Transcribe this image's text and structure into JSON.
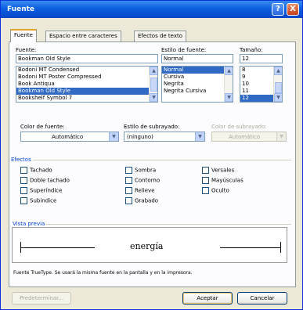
{
  "window": {
    "title": "Fuente",
    "help_glyph": "?",
    "close_glyph": "X"
  },
  "tabs": [
    "Fuente",
    "Espacio entre caracteres",
    "Efectos de texto"
  ],
  "font": {
    "label": "Fuente:",
    "value": "Bookman Old Style",
    "items": [
      "Bodoni MT Condensed",
      "Bodoni MT Poster Compressed",
      "Book Antiqua",
      "Bookman Old Style",
      "Bookshelf Symbol 7"
    ],
    "selected_index": 3
  },
  "style": {
    "label": "Estilo de fuente:",
    "value": "Normal",
    "items": [
      "Normal",
      "Cursiva",
      "Negrita",
      "Negrita Cursiva"
    ],
    "selected_index": 0
  },
  "size": {
    "label": "Tamaño:",
    "value": "12",
    "items": [
      "8",
      "9",
      "10",
      "11",
      "12"
    ],
    "selected_index": 4
  },
  "color": {
    "label": "Color de fuente:",
    "value": "Automático"
  },
  "underline": {
    "label": "Estilo de subrayado:",
    "value": "(ninguno)"
  },
  "underline_color": {
    "label": "Color de subrayado:",
    "value": "Automático"
  },
  "effects": {
    "title": "Efectos",
    "col1": [
      "Tachado",
      "Doble tachado",
      "Superíndice",
      "Subíndice"
    ],
    "col2": [
      "Sombra",
      "Contorno",
      "Relieve",
      "Grabado"
    ],
    "col3": [
      "Versales",
      "Mayúsculas",
      "Oculto"
    ]
  },
  "preview": {
    "title": "Vista previa",
    "sample": "energía"
  },
  "footnote": "Fuente TrueType. Se usará la misma fuente en la pantalla y en la impresora.",
  "buttons": {
    "default": "Predeterminar...",
    "ok": "Aceptar",
    "cancel": "Cancelar"
  },
  "scroll_glyphs": {
    "up": "▲",
    "down": "▼"
  }
}
